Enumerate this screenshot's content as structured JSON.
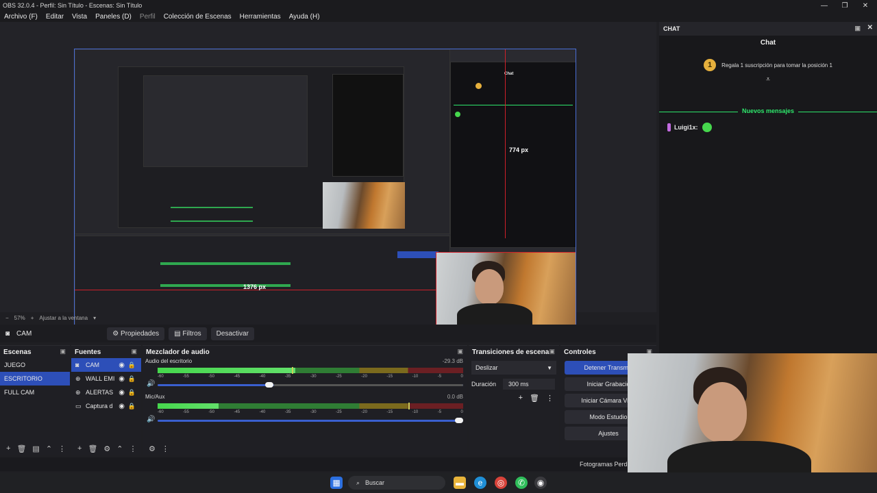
{
  "window": {
    "title": "OBS 32.0.4 - Perfil: Sin Título - Escenas: Sin Título",
    "controls": [
      "—",
      "❐",
      "✕"
    ]
  },
  "menu": [
    {
      "label": "Archivo (F)",
      "disabled": false
    },
    {
      "label": "Editar",
      "disabled": false
    },
    {
      "label": "Vista",
      "disabled": false
    },
    {
      "label": "Paneles (D)",
      "disabled": false
    },
    {
      "label": "Perfil",
      "disabled": true
    },
    {
      "label": "Colección de Escenas",
      "disabled": false
    },
    {
      "label": "Herramientas",
      "disabled": false
    },
    {
      "label": "Ayuda (H)",
      "disabled": false
    }
  ],
  "preview": {
    "measure_vertical": "774 px",
    "measure_horizontal": "1376 px",
    "zoom": "57%",
    "fit_label": "Ajustar a la ventana"
  },
  "source_toolbar": {
    "source_name": "CAM",
    "properties": "Propiedades",
    "filters": "Filtros",
    "deactivate": "Desactivar"
  },
  "scenes": {
    "title": "Escenas",
    "items": [
      "JUEGO",
      "ESCRITORIO",
      "FULL CAM"
    ],
    "selected": "ESCRITORIO"
  },
  "sources": {
    "title": "Fuentes",
    "items": [
      {
        "name": "CAM",
        "icon": "camera-icon",
        "selected": true
      },
      {
        "name": "WALL EMI",
        "icon": "globe-icon",
        "selected": false
      },
      {
        "name": "ALERTAS",
        "icon": "globe-icon",
        "selected": false
      },
      {
        "name": "Captura d",
        "icon": "monitor-icon",
        "selected": false
      }
    ]
  },
  "mixer": {
    "title": "Mezclador de audio",
    "channels": [
      {
        "name": "Audio del escritorio",
        "db": "-29.3 dB",
        "level": 0.45,
        "peak": 0.44,
        "volume": 0.38
      },
      {
        "name": "Mic/Aux",
        "db": "0.0 dB",
        "level": 0.2,
        "peak": 0.82,
        "volume": 1.0
      }
    ],
    "scale": [
      "-60",
      "-55",
      "-50",
      "-45",
      "-40",
      "-35",
      "-30",
      "-25",
      "-20",
      "-15",
      "-10",
      "-5",
      "0"
    ]
  },
  "transitions": {
    "title": "Transiciones de escena",
    "selected": "Deslizar",
    "duration_label": "Duración",
    "duration_value": "300 ms"
  },
  "controls": {
    "title": "Controles",
    "buttons": [
      "Detener Transmis",
      "Iniciar Grabació",
      "Iniciar Cámara Virtu",
      "Modo Estudio",
      "Ajustes"
    ]
  },
  "status": {
    "dropped_frames": "Fotogramas Perdi"
  },
  "chat": {
    "dock_title": "CHAT",
    "title": "Chat",
    "gift_rank": "1",
    "gift_text": "Regala 1 suscripción para tomar la posición 1",
    "new_messages": "Nuevos mensajes",
    "user": "Luigi1x:",
    "user_color": "#c26be0"
  },
  "taskbar": {
    "search": "Buscar"
  },
  "colors": {
    "accent": "#2d4fb8",
    "selection_border": "#d0202a",
    "chat_highlight": "#2ee86c",
    "gift": "#e6b03d"
  }
}
